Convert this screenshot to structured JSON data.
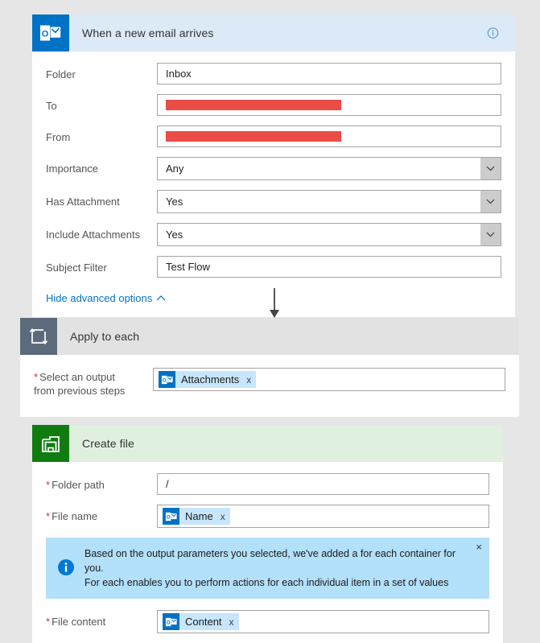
{
  "trigger": {
    "title": "When a new email arrives",
    "icon": "outlook-icon",
    "info_icon": "info-icon",
    "fields": [
      {
        "label": "Folder",
        "type": "text",
        "value": "Inbox"
      },
      {
        "label": "To",
        "type": "redacted",
        "value": ""
      },
      {
        "label": "From",
        "type": "redacted",
        "value": ""
      },
      {
        "label": "Importance",
        "type": "dropdown",
        "value": "Any"
      },
      {
        "label": "Has Attachment",
        "type": "dropdown",
        "value": "Yes"
      },
      {
        "label": "Include Attachments",
        "type": "dropdown",
        "value": "Yes"
      },
      {
        "label": "Subject Filter",
        "type": "text",
        "value": "Test Flow"
      }
    ],
    "advanced_link": "Hide advanced options"
  },
  "loop": {
    "title": "Apply to each",
    "icon": "loop-icon",
    "select_output": {
      "label_line1": "Select an output",
      "label_line2": "from previous steps",
      "required": true,
      "token": "Attachments",
      "token_icon": "outlook-icon",
      "token_remove": "x"
    }
  },
  "create_file": {
    "title": "Create file",
    "icon": "file-folder-icon",
    "folder_path": {
      "label": "Folder path",
      "required": true,
      "value": "/"
    },
    "file_name": {
      "label": "File name",
      "required": true,
      "token": "Name",
      "token_icon": "outlook-icon",
      "token_remove": "x"
    },
    "file_content": {
      "label": "File content",
      "required": true,
      "token": "Content",
      "token_icon": "outlook-icon",
      "token_remove": "x"
    }
  },
  "banner": {
    "icon": "info-circle-icon",
    "line1": "Based on the output parameters you selected, we've added a for each container for you.",
    "line2": "For each enables you to perform actions for each individual item in a set of values",
    "close": "×"
  },
  "colors": {
    "page_background": "#e6e6e6",
    "trigger_header": "#dbeaf6",
    "loop_header": "#e2e2e2",
    "action_header": "#dff0df",
    "outlook_blue": "#0072c6",
    "loop_slate": "#5c6b7c",
    "action_green": "#107c10",
    "link_blue": "#0072c6",
    "required_red": "#d13438",
    "redaction_red": "#ea4c46",
    "token_blue": "#c7e6fb",
    "banner_blue": "#b3e0fb"
  }
}
